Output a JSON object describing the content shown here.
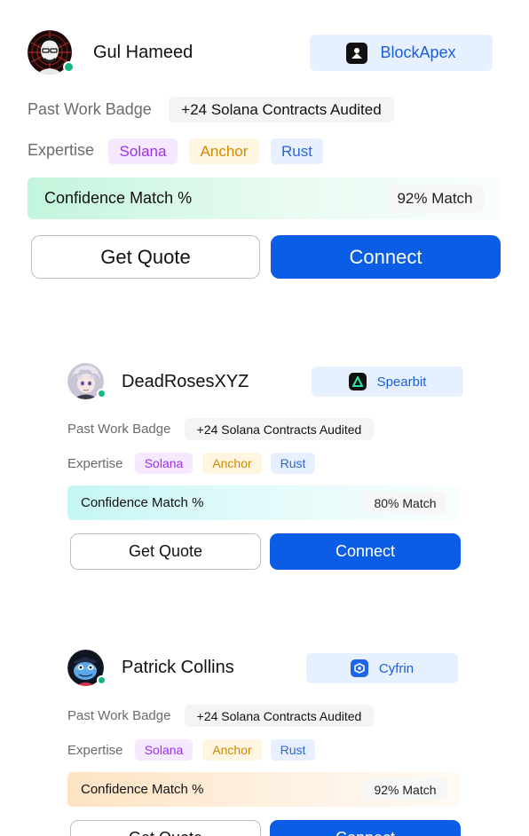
{
  "labels": {
    "past_work": "Past Work Badge",
    "expertise": "Expertise",
    "confidence": "Confidence Match %",
    "get_quote": "Get Quote",
    "connect": "Connect"
  },
  "colors": {
    "primary": "#0b5de6",
    "online": "#10b981",
    "org_text": "#1a5fe0",
    "tag_solana": "#9b30e6",
    "tag_anchor": "#cf8a00",
    "tag_rust": "#2a64d6"
  },
  "auditors": [
    {
      "name": "Gul Hameed",
      "avatar_icon": "portrait-glasses-icon",
      "online": true,
      "org": {
        "name": "BlockApex",
        "icon": "blockapex-logo-icon"
      },
      "past_work_badge": "+24 Solana Contracts Audited",
      "expertise": [
        "Solana",
        "Anchor",
        "Rust"
      ],
      "match": "92% Match",
      "confidence_tint": "mint"
    },
    {
      "name": "DeadRosesXYZ",
      "avatar_icon": "anime-portrait-icon",
      "online": true,
      "org": {
        "name": "Spearbit",
        "icon": "spearbit-logo-icon"
      },
      "past_work_badge": "+24 Solana Contracts Audited",
      "expertise": [
        "Solana",
        "Anchor",
        "Rust"
      ],
      "match": "80% Match",
      "confidence_tint": "cyan"
    },
    {
      "name": "Patrick Collins",
      "avatar_icon": "cartoon-frog-icon",
      "online": true,
      "org": {
        "name": "Cyfrin",
        "icon": "cyfrin-logo-icon"
      },
      "past_work_badge": "+24 Solana Contracts Audited",
      "expertise": [
        "Solana",
        "Anchor",
        "Rust"
      ],
      "match": "92% Match",
      "confidence_tint": "peach"
    }
  ]
}
